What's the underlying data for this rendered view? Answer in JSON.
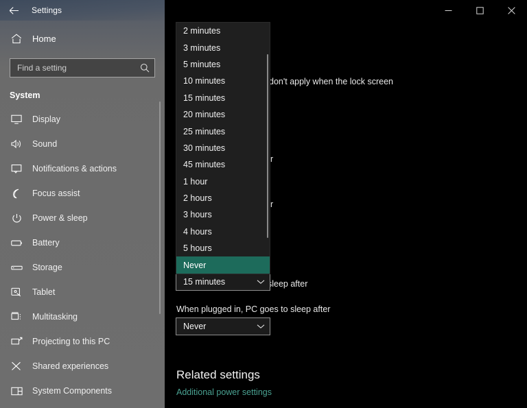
{
  "titlebar": {
    "back_icon": "arrow-left-icon",
    "title": "Settings",
    "minimize_icon": "minimize-icon",
    "maximize_icon": "maximize-icon",
    "close_icon": "close-icon"
  },
  "sidebar": {
    "home": {
      "label": "Home",
      "icon": "home-icon"
    },
    "search": {
      "placeholder": "Find a setting",
      "value": "",
      "icon": "search-icon"
    },
    "section_title": "System",
    "items": [
      {
        "label": "Display",
        "icon": "monitor-icon"
      },
      {
        "label": "Sound",
        "icon": "speaker-icon"
      },
      {
        "label": "Notifications & actions",
        "icon": "notification-icon"
      },
      {
        "label": "Focus assist",
        "icon": "moon-icon"
      },
      {
        "label": "Power & sleep",
        "icon": "power-icon"
      },
      {
        "label": "Battery",
        "icon": "battery-icon"
      },
      {
        "label": "Storage",
        "icon": "storage-icon"
      },
      {
        "label": "Tablet",
        "icon": "tablet-icon"
      },
      {
        "label": "Multitasking",
        "icon": "multitasking-icon"
      },
      {
        "label": "Projecting to this PC",
        "icon": "projecting-icon"
      },
      {
        "label": "Shared experiences",
        "icon": "shared-experiences-icon"
      },
      {
        "label": "System Components",
        "icon": "system-components-icon"
      }
    ]
  },
  "main": {
    "lock_screen_note": "don't apply when the lock screen",
    "fragment_screen_after_battery": "er",
    "fragment_screen_after_plugged": "er",
    "fragment_sleep_after_battery": "sleep after",
    "screen_battery_combo_value": "15 minutes",
    "plugged_sleep_label": "When plugged in, PC goes to sleep after",
    "plugged_sleep_value": "Never",
    "related_heading": "Related settings",
    "related_link": "Additional power settings"
  },
  "dropdown": {
    "selected": "Never",
    "options": [
      "2 minutes",
      "3 minutes",
      "5 minutes",
      "10 minutes",
      "15 minutes",
      "20 minutes",
      "25 minutes",
      "30 minutes",
      "45 minutes",
      "1 hour",
      "2 hours",
      "3 hours",
      "4 hours",
      "5 hours",
      "Never"
    ]
  },
  "colors": {
    "accent_teal": "#1d6b5b",
    "link_teal": "#4aa292",
    "sidebar_grey": "#6e6e6e",
    "panel_black": "#000000",
    "dropdown_bg": "#1f1f1f"
  }
}
